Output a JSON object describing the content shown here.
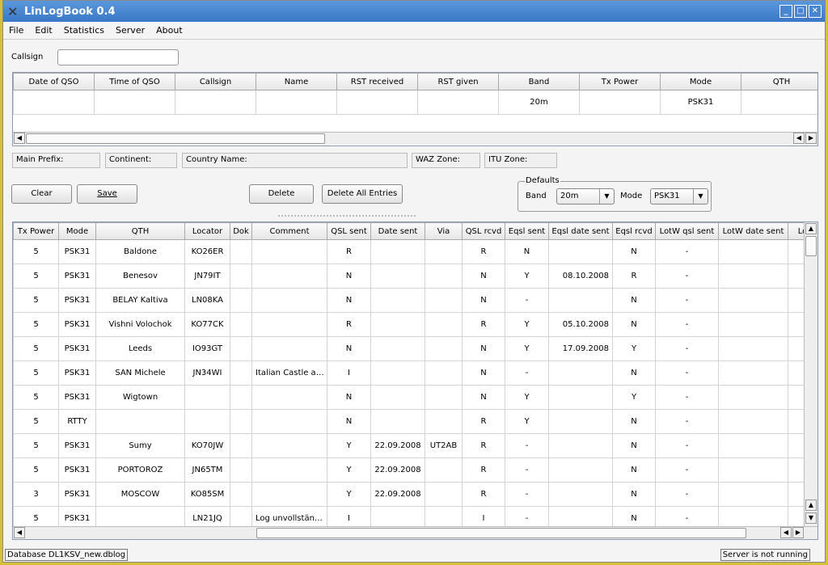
{
  "window": {
    "title": "LinLogBook 0.4"
  },
  "menu": [
    "File",
    "Edit",
    "Statistics",
    "Server",
    "About"
  ],
  "callsign": {
    "label": "Callsign",
    "value": ""
  },
  "entry_table": {
    "headers": [
      "Date of QSO",
      "Time of QSO",
      "Callsign",
      "Name",
      "RST received",
      "RST given",
      "Band",
      "Tx Power",
      "Mode",
      "QTH"
    ],
    "row": [
      "",
      "",
      "",
      "",
      "",
      "",
      "20m",
      "",
      "PSK31",
      ""
    ]
  },
  "info": {
    "main_prefix": "Main Prefix:",
    "continent": "Continent:",
    "country": "Country Name:",
    "waz": "WAZ Zone:",
    "itu": "ITU Zone:"
  },
  "buttons": {
    "clear": "Clear",
    "save": "Save",
    "delete": "Delete",
    "delete_all": "Delete All Entries"
  },
  "defaults": {
    "title": "Defaults",
    "band_label": "Band",
    "band": "20m",
    "mode_label": "Mode",
    "mode": "PSK31"
  },
  "log_table": {
    "headers": [
      "Tx Power",
      "Mode",
      "QTH",
      "Locator",
      "Dok",
      "Comment",
      "QSL sent",
      "Date sent",
      "Via",
      "QSL rcvd",
      "Eqsl sent",
      "Eqsl date sent",
      "Eqsl rcvd",
      "LotW qsl sent",
      "LotW date sent",
      "Lot"
    ],
    "rows": [
      [
        "5",
        "PSK31",
        "Baldone",
        "KO26ER",
        "",
        "",
        "R",
        "",
        "",
        "R",
        "N",
        "",
        "N",
        "-",
        "",
        ""
      ],
      [
        "5",
        "PSK31",
        "Benesov",
        "JN79IT",
        "",
        "",
        "N",
        "",
        "",
        "N",
        "Y",
        "08.10.2008",
        "R",
        "-",
        "",
        ""
      ],
      [
        "5",
        "PSK31",
        "BELAY Kaltiva",
        "LN08KA",
        "",
        "",
        "N",
        "",
        "",
        "N",
        "-",
        "",
        "N",
        "-",
        "",
        ""
      ],
      [
        "5",
        "PSK31",
        "Vishni Volochok",
        "KO77CK",
        "",
        "",
        "R",
        "",
        "",
        "R",
        "Y",
        "05.10.2008",
        "N",
        "-",
        "",
        ""
      ],
      [
        "5",
        "PSK31",
        "Leeds",
        "IO93GT",
        "",
        "",
        "N",
        "",
        "",
        "N",
        "Y",
        "17.09.2008",
        "Y",
        "-",
        "",
        ""
      ],
      [
        "5",
        "PSK31",
        "SAN Michele",
        "JN34WI",
        "",
        "Italian Castle aw...",
        "I",
        "",
        "",
        "N",
        "-",
        "",
        "N",
        "-",
        "",
        ""
      ],
      [
        "5",
        "PSK31",
        "Wigtown",
        "",
        "",
        "",
        "N",
        "",
        "",
        "N",
        "Y",
        "",
        "Y",
        "-",
        "",
        ""
      ],
      [
        "5",
        "RTTY",
        "",
        "",
        "",
        "",
        "N",
        "",
        "",
        "R",
        "Y",
        "",
        "N",
        "-",
        "",
        ""
      ],
      [
        "5",
        "PSK31",
        "Sumy",
        "KO70JW",
        "",
        "",
        "Y",
        "22.09.2008",
        "UT2AB",
        "R",
        "-",
        "",
        "N",
        "-",
        "",
        ""
      ],
      [
        "5",
        "PSK31",
        "PORTOROZ",
        "JN65TM",
        "",
        "",
        "Y",
        "22.09.2008",
        "",
        "R",
        "-",
        "",
        "N",
        "-",
        "",
        ""
      ],
      [
        "3",
        "PSK31",
        "MOSCOW",
        "KO85SM",
        "",
        "",
        "Y",
        "22.09.2008",
        "",
        "R",
        "-",
        "",
        "N",
        "-",
        "",
        ""
      ],
      [
        "5",
        "PSK31",
        "",
        "LN21JQ",
        "",
        "Log unvollständi...",
        "I",
        "",
        "",
        "I",
        "-",
        "",
        "N",
        "-",
        "",
        ""
      ]
    ]
  },
  "statusbar": {
    "database": "Database DL1KSV_new.dblog",
    "server": "Server is not running"
  }
}
